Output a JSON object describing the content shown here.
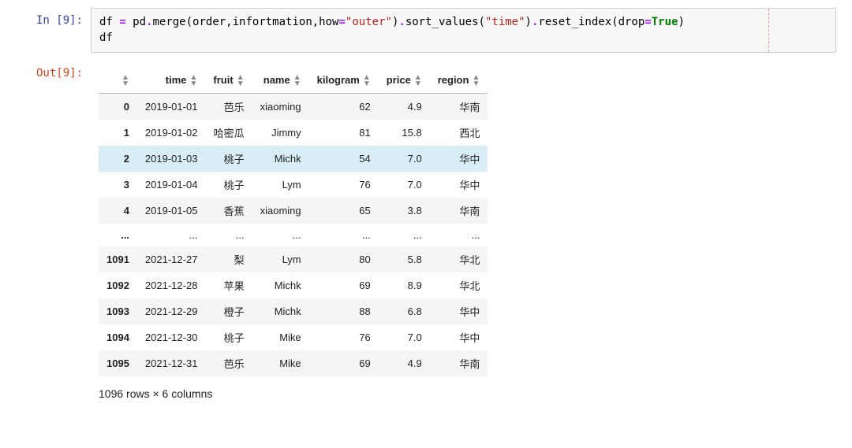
{
  "prompts": {
    "in": "In [9]:",
    "out": "Out[9]:"
  },
  "code": {
    "t1": "df ",
    "t2": "=",
    "t3": " pd",
    "t4": ".",
    "t5": "merge(order,infortmation,how",
    "t6": "=",
    "t7": "\"outer\"",
    "t8": ")",
    "t9": ".",
    "t10": "sort_values(",
    "t11": "\"time\"",
    "t12": ")",
    "t13": ".",
    "t14": "reset_index(drop",
    "t15": "=",
    "t16": "True",
    "t17": ")",
    "t18": "df"
  },
  "table": {
    "headers": [
      "",
      "time",
      "fruit",
      "name",
      "kilogram",
      "price",
      "region"
    ],
    "rows": [
      {
        "idx": "0",
        "time": "2019-01-01",
        "fruit": "芭乐",
        "name": "xiaoming",
        "kilogram": "62",
        "price": "4.9",
        "region": "华南",
        "hl": false
      },
      {
        "idx": "1",
        "time": "2019-01-02",
        "fruit": "哈密瓜",
        "name": "Jimmy",
        "kilogram": "81",
        "price": "15.8",
        "region": "西北",
        "hl": false
      },
      {
        "idx": "2",
        "time": "2019-01-03",
        "fruit": "桃子",
        "name": "Michk",
        "kilogram": "54",
        "price": "7.0",
        "region": "华中",
        "hl": true
      },
      {
        "idx": "3",
        "time": "2019-01-04",
        "fruit": "桃子",
        "name": "Lym",
        "kilogram": "76",
        "price": "7.0",
        "region": "华中",
        "hl": false
      },
      {
        "idx": "4",
        "time": "2019-01-05",
        "fruit": "香蕉",
        "name": "xiaoming",
        "kilogram": "65",
        "price": "3.8",
        "region": "华南",
        "hl": false
      },
      {
        "idx": "...",
        "time": "...",
        "fruit": "...",
        "name": "...",
        "kilogram": "...",
        "price": "...",
        "region": "...",
        "hl": false
      },
      {
        "idx": "1091",
        "time": "2021-12-27",
        "fruit": "梨",
        "name": "Lym",
        "kilogram": "80",
        "price": "5.8",
        "region": "华北",
        "hl": false
      },
      {
        "idx": "1092",
        "time": "2021-12-28",
        "fruit": "苹果",
        "name": "Michk",
        "kilogram": "69",
        "price": "8.9",
        "region": "华北",
        "hl": false
      },
      {
        "idx": "1093",
        "time": "2021-12-29",
        "fruit": "橙子",
        "name": "Michk",
        "kilogram": "88",
        "price": "6.8",
        "region": "华中",
        "hl": false
      },
      {
        "idx": "1094",
        "time": "2021-12-30",
        "fruit": "桃子",
        "name": "Mike",
        "kilogram": "76",
        "price": "7.0",
        "region": "华中",
        "hl": false
      },
      {
        "idx": "1095",
        "time": "2021-12-31",
        "fruit": "芭乐",
        "name": "Mike",
        "kilogram": "69",
        "price": "4.9",
        "region": "华南",
        "hl": false
      }
    ]
  },
  "shape": "1096 rows × 6 columns"
}
